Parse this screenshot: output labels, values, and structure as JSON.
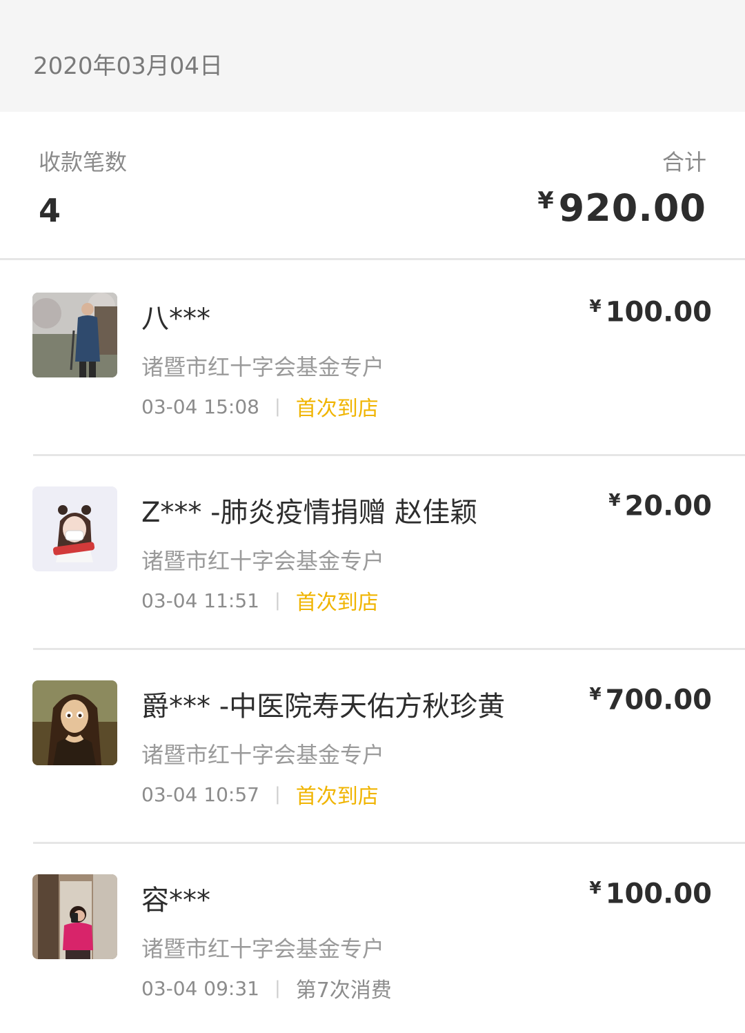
{
  "date": "2020年03月04日",
  "summary": {
    "count_label": "收款笔数",
    "count_value": "4",
    "total_label": "合计",
    "currency": "¥",
    "total_value": "920.00"
  },
  "transactions": [
    {
      "name": "八***",
      "account": "诸暨市红十字会基金专户",
      "time": "03-04 15:08",
      "tag": "首次到店",
      "amount": "100.00",
      "avatar": "photo-man-outdoors-icon"
    },
    {
      "name": "Z*** -肺炎疫情捐赠 赵佳颖",
      "account": "诸暨市红十字会基金专户",
      "time": "03-04 11:51",
      "tag": "首次到店",
      "amount": "20.00",
      "avatar": "cartoon-girl-mask-icon"
    },
    {
      "name": "爵*** -中医院寿天佑方秋珍黄",
      "account": "诸暨市红十字会基金专户",
      "time": "03-04 10:57",
      "tag": "首次到店",
      "amount": "700.00",
      "avatar": "mona-lisa-cartoon-icon"
    },
    {
      "name": "容***",
      "account": "诸暨市红十字会基金专户",
      "time": "03-04 09:31",
      "tag": "第7次消费",
      "amount": "100.00",
      "avatar": "selfie-mirror-icon"
    }
  ],
  "colors": {
    "tag_first": "#f0b400",
    "tag_repeat": "#8c8c8c",
    "header_bg": "#f5f5f5"
  }
}
